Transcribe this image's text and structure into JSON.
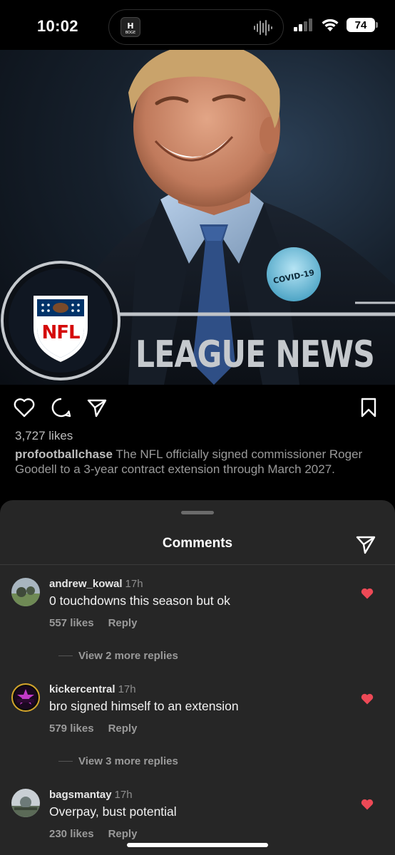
{
  "status": {
    "time": "10:02",
    "battery": "74",
    "island_app_label": "BOGE"
  },
  "post": {
    "image_banner": "LEAGUE NEWS",
    "logo_text": "NFL",
    "pin_text": "COVID-19",
    "likes": "3,727 likes",
    "username": "profootballchase",
    "caption": "The NFL officially signed commissioner Roger Goodell to a 3-year contract extension through March 2027."
  },
  "comments_sheet": {
    "title": "Comments",
    "comments": [
      {
        "user": "andrew_kowal",
        "time": "17h",
        "text": "0 touchdowns this season but ok",
        "likes": "557 likes",
        "reply": "Reply",
        "replies": "View 2 more replies",
        "liked": true
      },
      {
        "user": "kickercentral",
        "time": "17h",
        "text": "bro signed himself to an extension",
        "likes": "579 likes",
        "reply": "Reply",
        "replies": "View 3 more replies",
        "liked": true
      },
      {
        "user": "bagsmantay",
        "time": "17h",
        "text": "Overpay, bust potential",
        "likes": "230 likes",
        "reply": "Reply",
        "liked": true
      }
    ]
  },
  "colors": {
    "heart_liked": "#ed4956",
    "sheet_bg": "#262626"
  },
  "icons": [
    "heart-icon",
    "comment-icon",
    "share-icon",
    "bookmark-icon",
    "send-icon",
    "wifi-icon",
    "signal-icon"
  ]
}
